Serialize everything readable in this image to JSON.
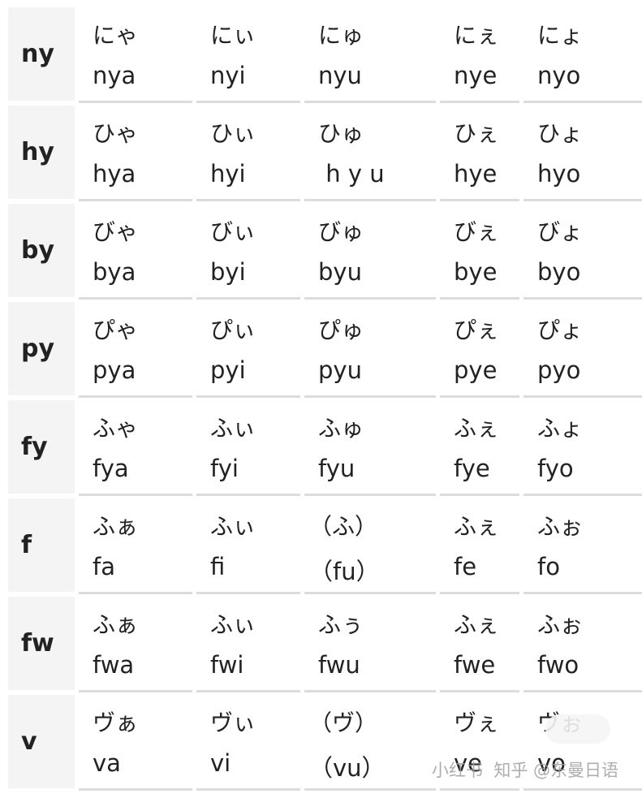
{
  "rows": [
    {
      "header": "ny",
      "cells": [
        [
          "にゃ",
          "nya"
        ],
        [
          "にぃ",
          "nyi"
        ],
        [
          "にゅ",
          "nyu"
        ],
        [
          "にぇ",
          "nye"
        ],
        [
          "にょ",
          "nyo"
        ]
      ]
    },
    {
      "header": "hy",
      "cells": [
        [
          "ひゃ",
          "hya"
        ],
        [
          "ひぃ",
          "hyi"
        ],
        [
          "ひゅ",
          " h y u"
        ],
        [
          "ひぇ",
          "hye"
        ],
        [
          "ひょ",
          "hyo"
        ]
      ]
    },
    {
      "header": "by",
      "cells": [
        [
          "びゃ",
          "bya"
        ],
        [
          "びぃ",
          "byi"
        ],
        [
          "びゅ",
          "byu"
        ],
        [
          "びぇ",
          "bye"
        ],
        [
          "びょ",
          "byo"
        ]
      ]
    },
    {
      "header": "py",
      "cells": [
        [
          "ぴゃ",
          "pya"
        ],
        [
          "ぴぃ",
          "pyi"
        ],
        [
          "ぴゅ",
          "pyu"
        ],
        [
          "ぴぇ",
          "pye"
        ],
        [
          "ぴょ",
          "pyo"
        ]
      ]
    },
    {
      "header": "fy",
      "cells": [
        [
          "ふゃ",
          "fya"
        ],
        [
          "ふぃ",
          "fyi"
        ],
        [
          "ふゅ",
          "fyu"
        ],
        [
          "ふぇ",
          "fye"
        ],
        [
          "ふょ",
          "fyo"
        ]
      ]
    },
    {
      "header": "f",
      "cells": [
        [
          "ふぁ",
          "fa"
        ],
        [
          "ふぃ",
          "fi"
        ],
        [
          "（ふ）",
          "（fu）"
        ],
        [
          "ふぇ",
          "fe"
        ],
        [
          "ふぉ",
          "fo"
        ]
      ]
    },
    {
      "header": "fw",
      "cells": [
        [
          "ふぁ",
          "fwa"
        ],
        [
          "ふぃ",
          "fwi"
        ],
        [
          "ふぅ",
          "fwu"
        ],
        [
          "ふぇ",
          "fwe"
        ],
        [
          "ふぉ",
          "fwo"
        ]
      ]
    },
    {
      "header": "v",
      "cells": [
        [
          "ヴぁ",
          "va"
        ],
        [
          "ヴぃ",
          "vi"
        ],
        [
          "（ヴ）",
          "（vu）"
        ],
        [
          "ヴぇ",
          "ve"
        ],
        [
          "ヴぉ",
          "vo"
        ]
      ]
    }
  ],
  "watermark": "小红书  知乎 @东曼日语"
}
